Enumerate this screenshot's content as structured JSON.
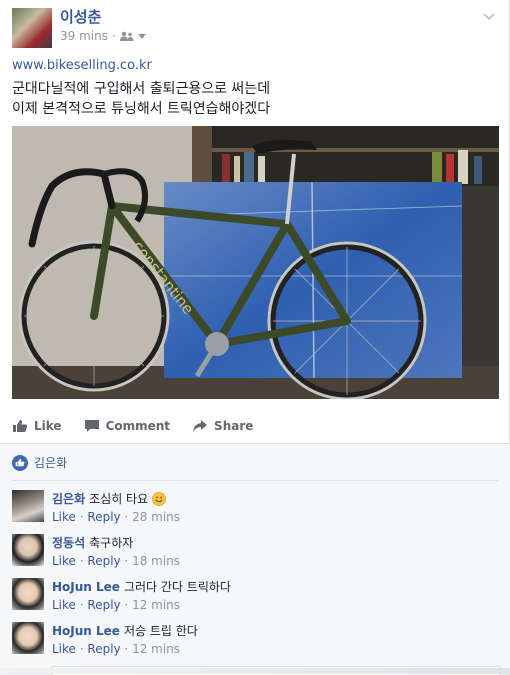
{
  "post": {
    "author": "이성춘",
    "time": "39 mins",
    "privacy_icon": "friends-icon",
    "link": "www.bikeselling.co.kr",
    "lines": [
      "군대다닐적에 구입해서 출퇴근용으로 써는데",
      "이제 본격적으로 튜닝해서 트릭연습해야겠다"
    ],
    "photo_text": "constantine"
  },
  "actions": {
    "like": "Like",
    "comment": "Comment",
    "share": "Share"
  },
  "likes": {
    "names": "김은화"
  },
  "comments": [
    {
      "author": "김은화",
      "text": "조심히 타요",
      "emoji": "smile",
      "like": "Like",
      "reply": "Reply",
      "time": "28 mins"
    },
    {
      "author": "정동석",
      "text": "축구하자",
      "like": "Like",
      "reply": "Reply",
      "time": "18 mins"
    },
    {
      "author": "HoJun Lee",
      "text": "그러다 간다 트릭하다",
      "like": "Like",
      "reply": "Reply",
      "time": "12 mins"
    },
    {
      "author": "HoJun Lee",
      "text": "저승 트립 한다",
      "like": "Like",
      "reply": "Reply",
      "time": "12 mins"
    }
  ],
  "colors": {
    "link_blue": "#365899",
    "like_blue": "#4267b2",
    "meta_gray": "#90949c",
    "action_gray": "#606770"
  }
}
